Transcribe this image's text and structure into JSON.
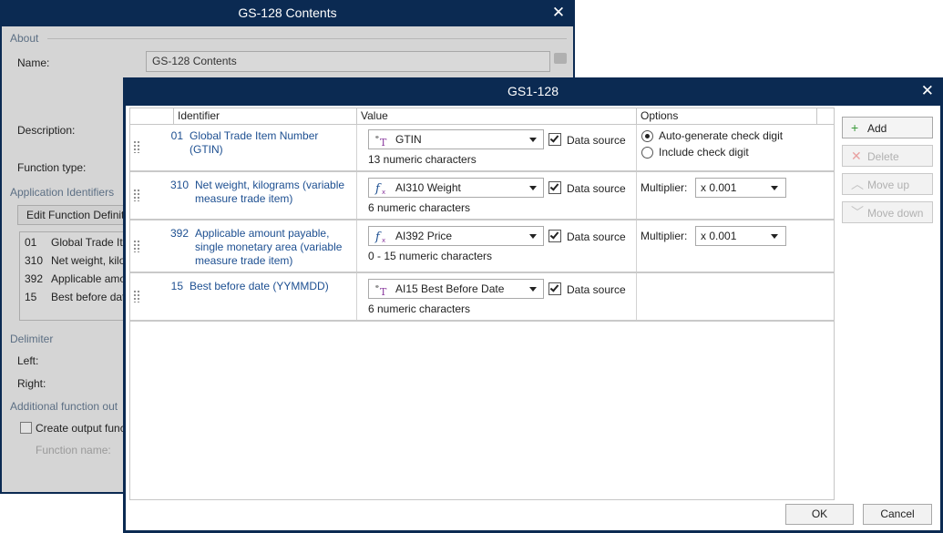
{
  "back_window": {
    "title": "GS-128 Contents",
    "about_section": "About",
    "name_label": "Name:",
    "name_value": "GS-128 Contents",
    "description_label": "Description:",
    "function_type_label": "Function type:",
    "app_identifiers_section": "Application Identifiers",
    "edit_button": "Edit Function Definiti",
    "ai_list": [
      {
        "num": "01",
        "text": "Global Trade Ite"
      },
      {
        "num": "310",
        "text": "Net weight, kilogi"
      },
      {
        "num": "392",
        "text": "Applicable amo"
      },
      {
        "num": "15",
        "text": "Best before dat"
      }
    ],
    "delimiter_section": "Delimiter",
    "left_label": "Left:",
    "right_label": "Right:",
    "additional_section": "Additional function out",
    "create_output_label": "Create output func",
    "function_name_label": "Function name:"
  },
  "dialog": {
    "title": "GS1-128",
    "columns": [
      "Identifier",
      "Value",
      "Options"
    ],
    "rows": [
      {
        "num": "01",
        "name": "Global Trade Item Number (GTIN)",
        "value_icon": "variable-icon",
        "value": "GTIN",
        "data_source": "Data source",
        "hint": "13 numeric characters",
        "options": {
          "radio1": "Auto-generate check digit",
          "radio2": "Include check digit"
        }
      },
      {
        "num": "310",
        "name": "Net weight, kilograms (variable measure trade item)",
        "value_icon": "function-icon",
        "value": "AI310 Weight",
        "data_source": "Data source",
        "hint": "6 numeric characters",
        "options": {
          "multiplier_label": "Multiplier:",
          "multiplier": "x 0.001"
        }
      },
      {
        "num": "392",
        "name": "Applicable amount payable, single monetary area (variable measure trade item)",
        "value_icon": "function-icon",
        "value": "AI392 Price",
        "data_source": "Data source",
        "hint": "0 - 15 numeric characters",
        "options": {
          "multiplier_label": "Multiplier:",
          "multiplier": "x 0.001"
        }
      },
      {
        "num": "15",
        "name": "Best before date (YYMMDD)",
        "value_icon": "variable-icon",
        "value": "AI15 Best Before Date",
        "data_source": "Data source",
        "hint": "6 numeric characters"
      }
    ],
    "buttons": {
      "add": "Add",
      "delete": "Delete",
      "move_up": "Move up",
      "move_down": "Move down",
      "ok": "OK",
      "cancel": "Cancel"
    },
    "colors": {
      "titlebar": "#0b2a52",
      "link_text": "#1d4f91",
      "add_icon": "#3a9a3a",
      "delete_icon": "#e07a7a"
    }
  }
}
